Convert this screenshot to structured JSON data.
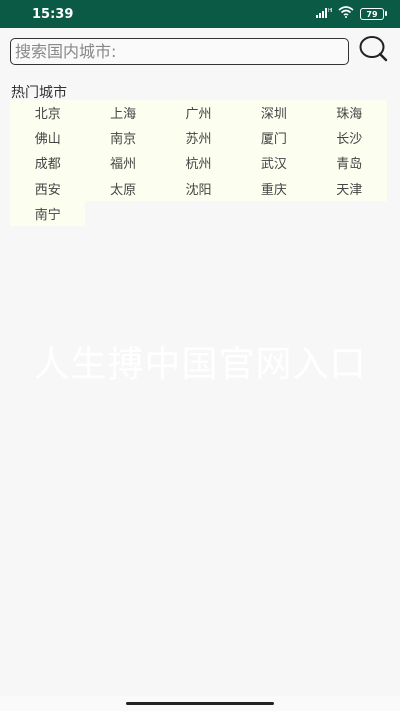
{
  "status_bar": {
    "time": "15:39",
    "signal_text": "HD",
    "battery": "79",
    "background_color": "#0b5a45"
  },
  "search": {
    "placeholder": "搜索国内城市:",
    "icon": "search-icon"
  },
  "hot_cities": {
    "title": "热门城市",
    "cities": [
      "北京",
      "上海",
      "广州",
      "深圳",
      "珠海",
      "佛山",
      "南京",
      "苏州",
      "厦门",
      "长沙",
      "成都",
      "福州",
      "杭州",
      "武汉",
      "青岛",
      "西安",
      "太原",
      "沈阳",
      "重庆",
      "天津",
      "南宁"
    ],
    "cell_color": "#fcfef0"
  },
  "watermark": "人生搏中国官网入口"
}
